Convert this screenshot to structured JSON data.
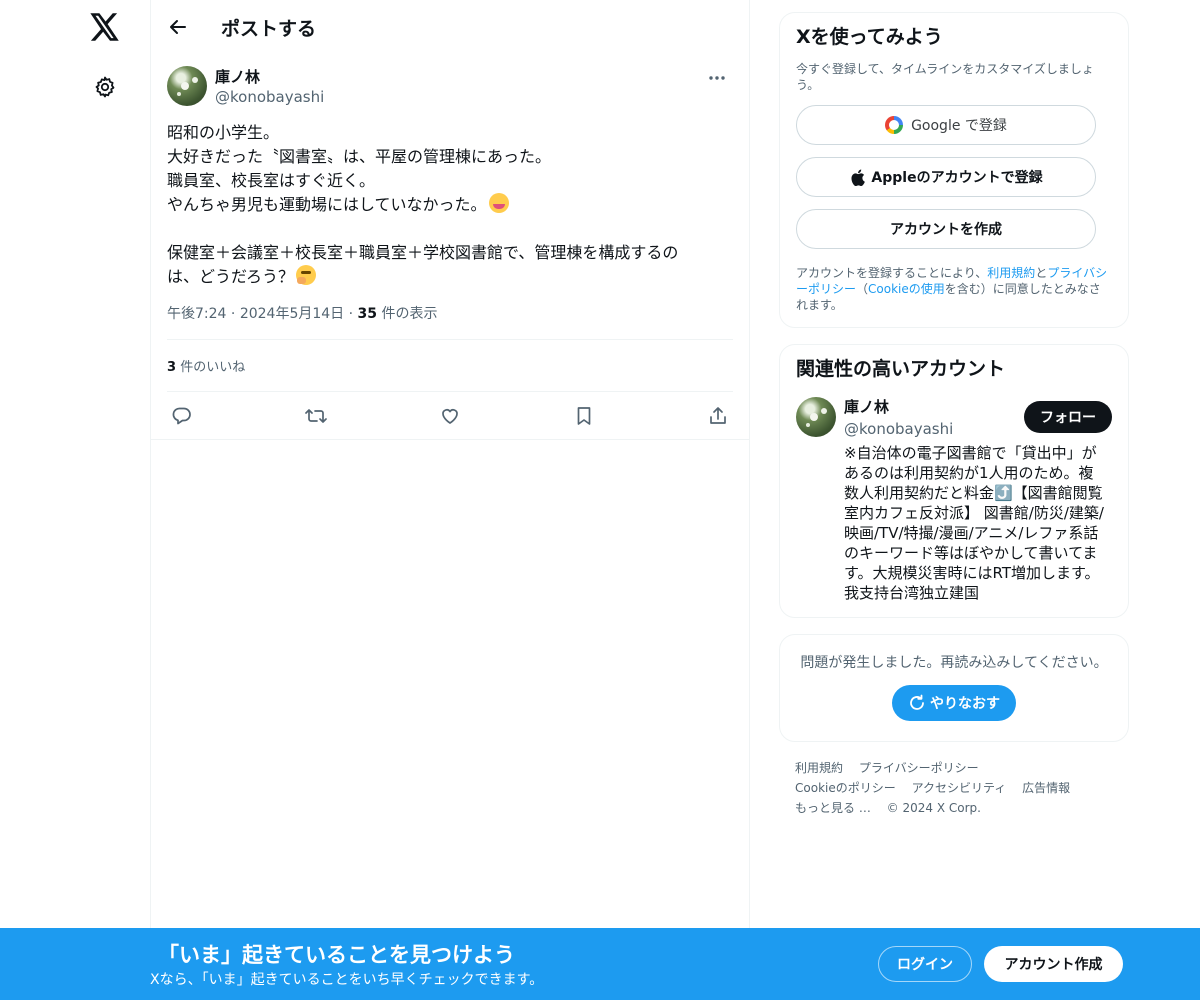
{
  "header": {
    "title": "ポストする"
  },
  "post": {
    "author_name": "庫ノ林",
    "author_handle": "@konobayashi",
    "lines": [
      "昭和の小学生。",
      "大好きだった〝図書室〟は、平屋の管理棟にあった。",
      "職員室、校長室はすぐ近く。",
      "やんちゃ男児も運動場にはしていなかった。",
      "",
      "保健室＋会議室＋校長室＋職員室＋学校図書館で、管理棟を構成するの",
      "は、どうだろう？"
    ],
    "time": "午後7:24",
    "date": "2024年5月14日",
    "views_count": "35",
    "views_label": "件の表示",
    "likes_count": "3",
    "likes_label": "件のいいね"
  },
  "signup": {
    "title": "Xを使ってみよう",
    "subtitle": "今すぐ登録して、タイムラインをカスタマイズしましょう。",
    "google_label": "Google で登録",
    "apple_label": "Appleのアカウントで登録",
    "create_label": "アカウントを作成",
    "legal_pre": "アカウントを登録することにより、",
    "terms_link": "利用規約",
    "legal_and": "と",
    "privacy_link": "プライバシーポリシー",
    "legal_paren_open": "（",
    "cookie_link": "Cookieの使用",
    "legal_post": "を含む）に同意したとみなされます。"
  },
  "related": {
    "title": "関連性の高いアカウント",
    "name": "庫ノ林",
    "handle": "@konobayashi",
    "follow_label": "フォロー",
    "bio": "※自治体の電子図書館で「貸出中」があるのは利用契約が1人用のため。複数人利用契約だと料金⤴️【図書館閲覧室内カフェ反対派】 図書館/防災/建築/映画/TV/特撮/漫画/アニメ/レファ系話のキーワード等はぼやかして書いてます。大規模災害時にはRT増加します。我支持台湾独立建国"
  },
  "error": {
    "message": "問題が発生しました。再読み込みしてください。",
    "retry_label": "やりなおす"
  },
  "footer": {
    "terms": "利用規約",
    "privacy": "プライバシーポリシー",
    "cookie": "Cookieのポリシー",
    "accessibility": "アクセシビリティ",
    "ads": "広告情報",
    "more": "もっと見る …",
    "copyright": "© 2024 X Corp."
  },
  "banner": {
    "title": "「いま」起きていることを見つけよう",
    "subtitle": "Xなら、「いま」起きていることをいち早くチェックできます。",
    "login_label": "ログイン",
    "signup_label": "アカウント作成"
  },
  "icons": {
    "logo": "x-logo-icon",
    "settings": "gear-icon",
    "back": "back-arrow-icon",
    "more": "more-icon",
    "reply": "reply-icon",
    "repost": "repost-icon",
    "like": "heart-icon",
    "bookmark": "bookmark-icon",
    "share": "share-icon",
    "apple": "apple-icon",
    "google": "google-icon",
    "retry": "refresh-icon"
  },
  "colors": {
    "accent": "#1d9bf0",
    "text": "#0f1419",
    "muted": "#536471",
    "border": "#eff3f4"
  }
}
